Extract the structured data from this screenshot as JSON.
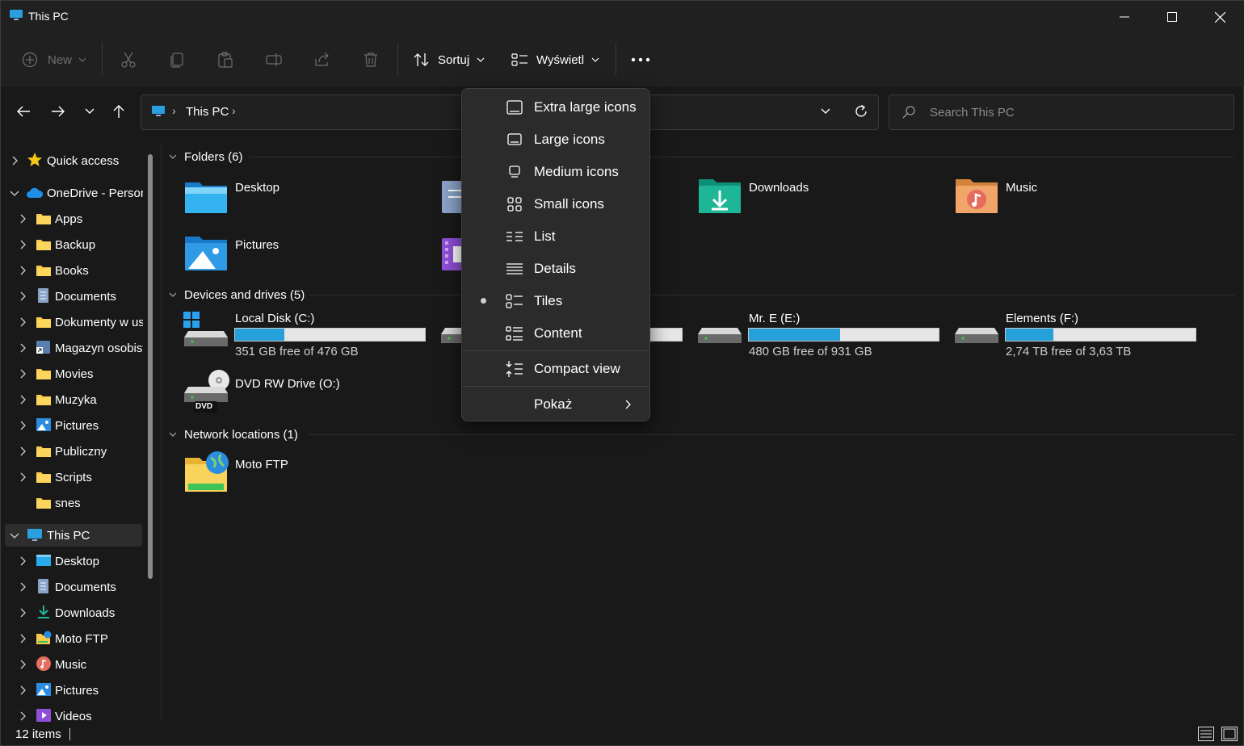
{
  "window": {
    "title": "This PC"
  },
  "commandbar": {
    "new_label": "New",
    "sort_label": "Sortuj",
    "view_label": "Wyświetl"
  },
  "address": {
    "location": "This PC",
    "search_placeholder": "Search This PC"
  },
  "sidebar": {
    "items": [
      {
        "label": "Quick access",
        "icon": "star-icon"
      },
      {
        "label": "OneDrive - Personal",
        "icon": "cloud-icon"
      },
      {
        "label": "Apps",
        "icon": "folder-icon"
      },
      {
        "label": "Backup",
        "icon": "folder-icon"
      },
      {
        "label": "Books",
        "icon": "folder-icon"
      },
      {
        "label": "Documents",
        "icon": "documents-icon"
      },
      {
        "label": "Dokumenty w usłudze",
        "icon": "folder-icon"
      },
      {
        "label": "Magazyn osobisty",
        "icon": "vault-icon"
      },
      {
        "label": "Movies",
        "icon": "folder-icon"
      },
      {
        "label": "Muzyka",
        "icon": "folder-icon"
      },
      {
        "label": "Pictures",
        "icon": "pictures-icon"
      },
      {
        "label": "Publiczny",
        "icon": "folder-icon"
      },
      {
        "label": "Scripts",
        "icon": "folder-icon"
      },
      {
        "label": "snes",
        "icon": "folder-icon"
      },
      {
        "label": "This PC",
        "icon": "computer-icon"
      },
      {
        "label": "Desktop",
        "icon": "desktop-icon"
      },
      {
        "label": "Documents",
        "icon": "documents-icon"
      },
      {
        "label": "Downloads",
        "icon": "downloads-icon"
      },
      {
        "label": "Moto FTP",
        "icon": "network-folder-icon"
      },
      {
        "label": "Music",
        "icon": "music-icon"
      },
      {
        "label": "Pictures",
        "icon": "pictures-icon"
      },
      {
        "label": "Videos",
        "icon": "videos-icon"
      }
    ]
  },
  "groups": {
    "folders": "Folders (6)",
    "devices": "Devices and drives (5)",
    "network": "Network locations (1)"
  },
  "folders": [
    {
      "label": "Desktop"
    },
    {
      "label": "Downloads"
    },
    {
      "label": "Music"
    },
    {
      "label": "Pictures"
    }
  ],
  "drives": [
    {
      "label": "Local Disk (C:)",
      "free": "351 GB free of 476 GB",
      "used_fraction": 0.26
    },
    {
      "label": "Mr. E (E:)",
      "free": "480 GB free of 931 GB",
      "used_fraction": 0.48
    },
    {
      "label": "Elements (F:)",
      "free": "2,74 TB free of 3,63 TB",
      "used_fraction": 0.25
    },
    {
      "label": "DVD RW Drive (O:)",
      "badge": "DVD"
    }
  ],
  "network": [
    {
      "label": "Moto FTP"
    }
  ],
  "view_menu": {
    "items": [
      {
        "label": "Extra large icons",
        "icon": "extra-large-icons-icon"
      },
      {
        "label": "Large icons",
        "icon": "large-icons-icon"
      },
      {
        "label": "Medium icons",
        "icon": "medium-icons-icon"
      },
      {
        "label": "Small icons",
        "icon": "small-icons-icon"
      },
      {
        "label": "List",
        "icon": "list-icon"
      },
      {
        "label": "Details",
        "icon": "details-icon"
      },
      {
        "label": "Tiles",
        "icon": "tiles-icon",
        "selected": true
      },
      {
        "label": "Content",
        "icon": "content-icon"
      }
    ],
    "compact_label": "Compact view",
    "show_label": "Pokaż"
  },
  "status": {
    "items_count": "12 items"
  },
  "colors": {
    "accent": "#26a0da",
    "background": "#191919",
    "menu_bg": "#2b2b2b"
  }
}
